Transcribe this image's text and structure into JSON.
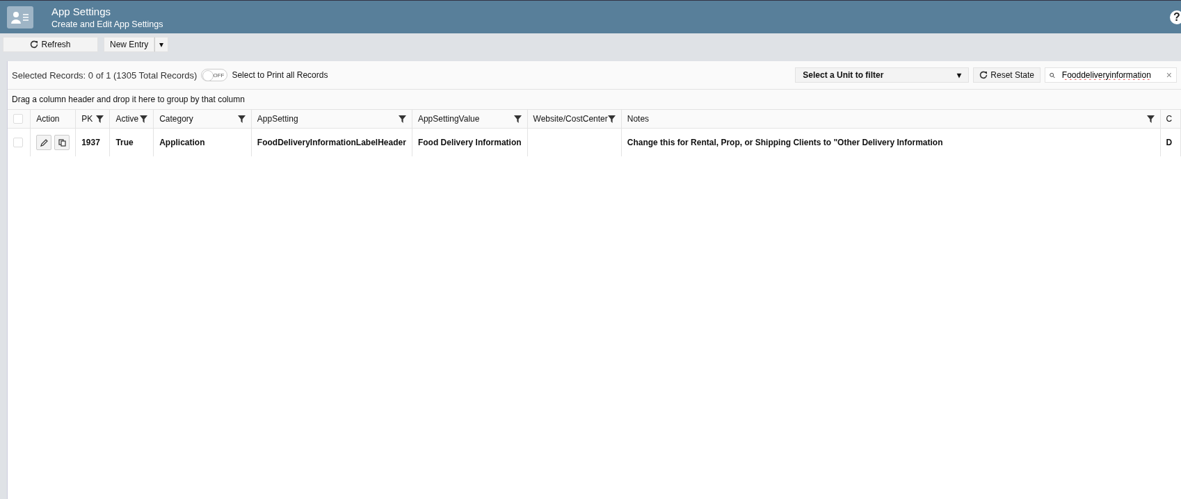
{
  "header": {
    "title": "App Settings",
    "subtitle": "Create and Edit App Settings",
    "help": "?"
  },
  "toolbar": {
    "refresh": "Refresh",
    "new_entry": "New Entry",
    "dropdown": "▾"
  },
  "summary": {
    "selected_text": "Selected Records: 0 of 1 (1305 Total Records)",
    "print_toggle": {
      "on": false,
      "label": "OFF"
    },
    "print_label": "Select to Print all Records"
  },
  "unit_filter": {
    "value": "Select a Unit to filter",
    "caret": "▾"
  },
  "reset_state": "Reset State",
  "search": {
    "value": "Fooddeliveryinformation",
    "clear": "×"
  },
  "group_hint": "Drag a column header and drop it here to group by that column",
  "table": {
    "select_all": {
      "checked": false
    },
    "columns": [
      {
        "label": "Action",
        "filter": false
      },
      {
        "label": "PK",
        "filter": true
      },
      {
        "label": "Active",
        "filter": true
      },
      {
        "label": "Category",
        "filter": true
      },
      {
        "label": "AppSetting",
        "filter": true
      },
      {
        "label": "AppSettingValue",
        "filter": true
      },
      {
        "label": "Website/CostCenter",
        "filter": true
      },
      {
        "label": "Notes",
        "filter": true
      },
      {
        "label": "C",
        "filter": false
      }
    ],
    "rows": [
      {
        "checked": false,
        "cells": [
          "",
          "1937",
          "True",
          "Application",
          "FoodDeliveryInformationLabelHeader",
          "Food Delivery Information",
          "",
          "Change this for Rental, Prop, or Shipping Clients to \"Other Delivery Information",
          "D"
        ]
      }
    ]
  }
}
